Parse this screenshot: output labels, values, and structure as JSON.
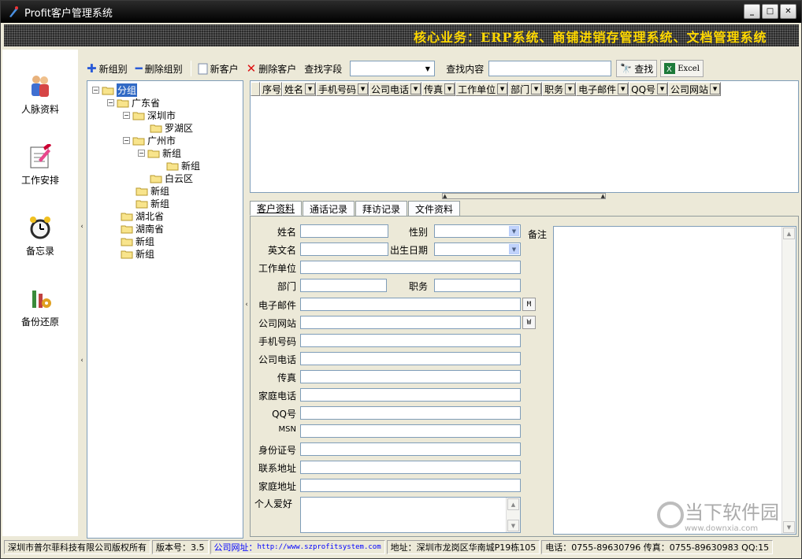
{
  "window": {
    "title": "Profit客户管理系统"
  },
  "banner": {
    "text": "核心业务：ERP系统、商铺进销存管理系统、文档管理系统"
  },
  "nav": {
    "items": [
      {
        "label": "人脉资料",
        "icon": "people-icon"
      },
      {
        "label": "工作安排",
        "icon": "notepad-icon"
      },
      {
        "label": "备忘录",
        "icon": "alarm-clock-icon"
      },
      {
        "label": "备份还原",
        "icon": "tools-icon"
      }
    ]
  },
  "toolbar": {
    "new_group": "新组别",
    "delete_group": "删除组别",
    "new_customer": "新客户",
    "delete_customer": "删除客户",
    "search_field_label": "查找字段",
    "search_field_value": "",
    "search_content_label": "查找内容",
    "search_content_value": "",
    "search_button": "查找",
    "excel_button": "Excel"
  },
  "tree": {
    "root": "分组",
    "nodes": [
      "广东省",
      "深圳市",
      "罗湖区",
      "广州市",
      "新组",
      "新组",
      "白云区",
      "新组",
      "新组",
      "湖北省",
      "湖南省",
      "新组",
      "新组"
    ]
  },
  "grid": {
    "columns": [
      "序号",
      "姓名",
      "手机号码",
      "公司电话",
      "传真",
      "工作单位",
      "部门",
      "职务",
      "电子邮件",
      "QQ号",
      "公司网站"
    ]
  },
  "tabs": [
    "客户资料",
    "通话记录",
    "拜访记录",
    "文件资料"
  ],
  "form": {
    "name": "姓名",
    "gender": "性别",
    "remark": "备注",
    "english_name": "英文名",
    "birthday": "出生日期",
    "company": "工作单位",
    "department": "部门",
    "position": "职务",
    "email": "电子邮件",
    "website": "公司网站",
    "mobile": "手机号码",
    "company_phone": "公司电话",
    "fax": "传真",
    "home_phone": "家庭电话",
    "qq": "QQ号",
    "msn": "MSN",
    "id_number": "身份证号",
    "contact_address": "联系地址",
    "home_address": "家庭地址",
    "hobby": "个人爱好",
    "email_btn": "M",
    "web_btn": "W"
  },
  "status": {
    "copyright": "深圳市普尔菲科技有限公司版权所有",
    "version": "版本号：3.5",
    "website_label": "公司网址：",
    "website_url": "http://www.szprofitsystem.com",
    "address": "地址：深圳市龙岗区华南城P19栋105",
    "phone": "电话：0755-89630796 传真：0755-89630983 QQ:15"
  },
  "watermark": {
    "text": "当下软件园",
    "url": "www.downxia.com"
  }
}
